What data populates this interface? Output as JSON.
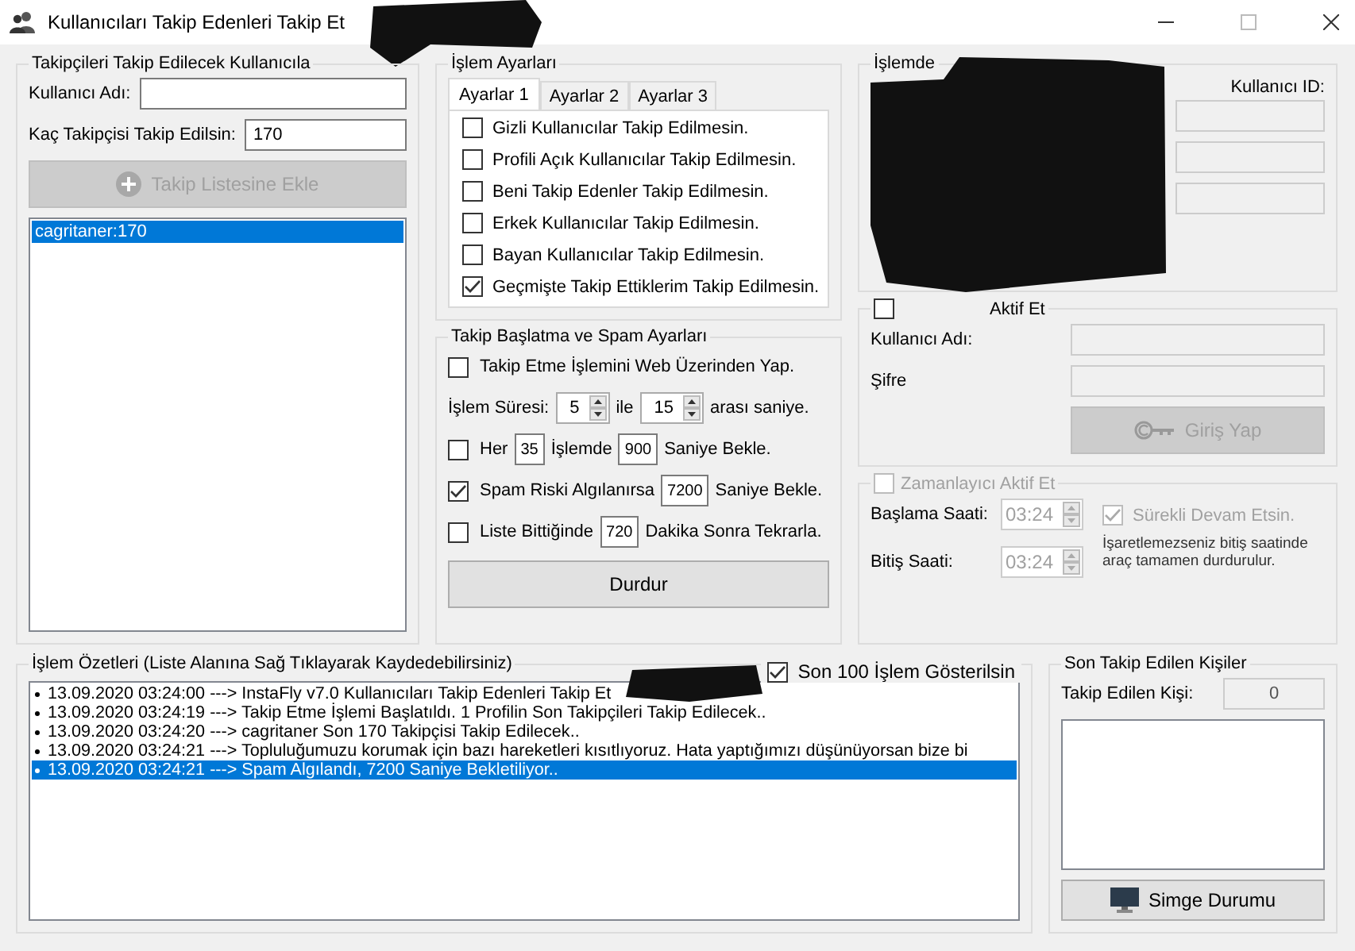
{
  "window": {
    "title": "Kullanıcıları Takip Edenleri Takip Et"
  },
  "targets": {
    "title": "Takipçileri Takip Edilecek Kullanıcıla",
    "fields": [
      {
        "label": "Kullanıcı Adı:"
      },
      {
        "label": "Kaç Takipçisi Takip Edilsin:",
        "value": "170"
      }
    ],
    "add_button": {
      "label": "Takip Listesine Ekle",
      "disabled": true
    },
    "list": [
      {
        "text": "cagritaner:170",
        "selected": true
      }
    ]
  },
  "settings": {
    "title": "İşlem Ayarları",
    "tabs": [
      {
        "label": "Ayarlar 1",
        "selected": true
      },
      {
        "label": "Ayarlar 2",
        "selected": false
      },
      {
        "label": "Ayarlar 3",
        "selected": false
      }
    ],
    "options": [
      {
        "label": "Gizli Kullanıcılar Takip Edilmesin.",
        "checked": false
      },
      {
        "label": "Profili Açık Kullanıcılar Takip Edilmesin.",
        "checked": false
      },
      {
        "label": "Beni Takip Edenler Takip Edilmesin.",
        "checked": false
      },
      {
        "label": "Erkek Kullanıcılar Takip Edilmesin.",
        "checked": false
      },
      {
        "label": "Bayan Kullanıcılar Takip Edilmesin.",
        "checked": false
      },
      {
        "label": "Geçmişte Takip Ettiklerim Takip Edilmesin.",
        "checked": true
      }
    ]
  },
  "spam": {
    "title": "Takip Başlatma ve Spam Ayarları",
    "rows": [
      {
        "kind": "checkbox",
        "checked": false,
        "parts": [
          {
            "kind": "text",
            "text": "Takip Etme İşlemini Web Üzerinden Yap."
          }
        ]
      },
      {
        "kind": "plain",
        "parts": [
          {
            "kind": "text",
            "text": "İşlem Süresi:"
          },
          {
            "kind": "spin",
            "value": "5"
          },
          {
            "kind": "text",
            "text": "ile"
          },
          {
            "kind": "spin",
            "value": "15"
          },
          {
            "kind": "text",
            "text": "arası saniye."
          }
        ]
      },
      {
        "kind": "checkbox",
        "checked": false,
        "parts": [
          {
            "kind": "text",
            "text": "Her"
          },
          {
            "kind": "number",
            "value": "35"
          },
          {
            "kind": "text",
            "text": "İşlemde"
          },
          {
            "kind": "number",
            "value": "900"
          },
          {
            "kind": "text",
            "text": "Saniye Bekle."
          }
        ]
      },
      {
        "kind": "checkbox",
        "checked": true,
        "parts": [
          {
            "kind": "text",
            "text": "Spam Riski Algılanırsa"
          },
          {
            "kind": "number",
            "value": "7200"
          },
          {
            "kind": "text",
            "text": "Saniye Bekle."
          }
        ]
      },
      {
        "kind": "checkbox",
        "checked": false,
        "parts": [
          {
            "kind": "text",
            "text": "Liste Bittiğinde"
          },
          {
            "kind": "number",
            "value": "720"
          },
          {
            "kind": "text",
            "text": "Dakika Sonra Tekrarla."
          }
        ]
      }
    ],
    "stop_button": "Durdur"
  },
  "active_user": {
    "title": "İşlemde",
    "fields": [
      {
        "label": "Kullanıcı ID:",
        "disabled": true
      },
      {
        "disabled": true
      },
      {
        "disabled": true
      }
    ]
  },
  "spy": {
    "label": "Aktif Et",
    "checked": false,
    "fields": [
      {
        "label": "Kullanıcı Adı:",
        "disabled": true
      },
      {
        "label": "Şifre",
        "disabled": true
      }
    ],
    "login_button": {
      "label": "Giriş Yap",
      "disabled": true
    }
  },
  "timer": {
    "label": "Zamanlayıcı Aktif Et",
    "checked": false,
    "disabled": true,
    "times": [
      {
        "label": "Başlama Saati:",
        "value": "03:24"
      },
      {
        "label": "Bitiş Saati:",
        "value": "03:24"
      }
    ],
    "continuous": {
      "label": "Sürekli Devam Etsin.",
      "checked": true
    },
    "note": "İşaretlemezseniz bitiş saatinde araç tamamen durdurulur."
  },
  "log": {
    "title": "İşlem Özetleri (Liste Alanına Sağ Tıklayarak Kaydedebilirsiniz)",
    "show_last": {
      "label": "Son 100 İşlem Gösterilsin",
      "checked": true
    },
    "entries": [
      {
        "text": "13.09.2020 03:24:00 ---> InstaFly v7.0 Kullanıcıları Takip Edenleri Takip Et",
        "selected": false
      },
      {
        "text": "13.09.2020 03:24:19 ---> Takip Etme İşlemi Başlatıldı. 1 Profilin Son Takipçileri Takip Edilecek..",
        "selected": false
      },
      {
        "text": "13.09.2020 03:24:20 ---> cagritaner Son 170 Takipçisi Takip Edilecek..",
        "selected": false
      },
      {
        "text": "13.09.2020 03:24:21 ---> Topluluğumuzu korumak için bazı hareketleri kısıtlıyoruz. Hata yaptığımızı düşünüyorsan bize bi",
        "selected": false
      },
      {
        "text": "13.09.2020 03:24:21 ---> Spam Algılandı, 7200 Saniye Bekletiliyor..",
        "selected": true
      }
    ]
  },
  "followed": {
    "title": "Son Takip Edilen Kişiler",
    "count_label": "Takip Edilen Kişi:",
    "count": "0",
    "minimize_button": "Simge Durumu"
  }
}
